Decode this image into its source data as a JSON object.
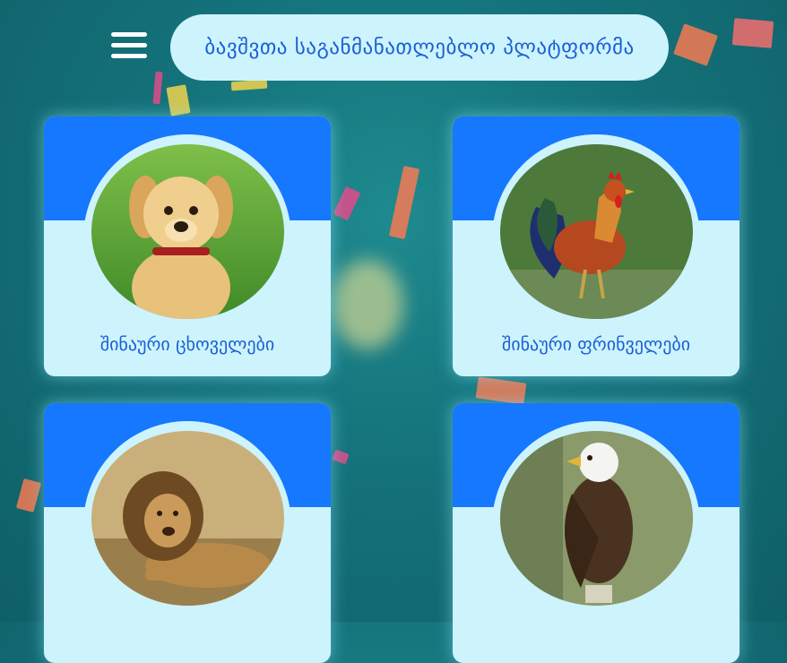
{
  "header": {
    "title": "ბავშვთა საგანმანათლებლო პლატფორმა",
    "menu_icon": "hamburger-menu-icon"
  },
  "cards": [
    {
      "label": "შინაური ცხოველები",
      "image": "puppy-photo"
    },
    {
      "label": "შინაური ფრინველები",
      "image": "rooster-photo"
    },
    {
      "label": "",
      "image": "lion-photo"
    },
    {
      "label": "",
      "image": "eagle-photo"
    }
  ],
  "colors": {
    "background": "#14727a",
    "card_top": "#1677ff",
    "card_body": "#cdf3fd",
    "text": "#1a5fd4"
  }
}
